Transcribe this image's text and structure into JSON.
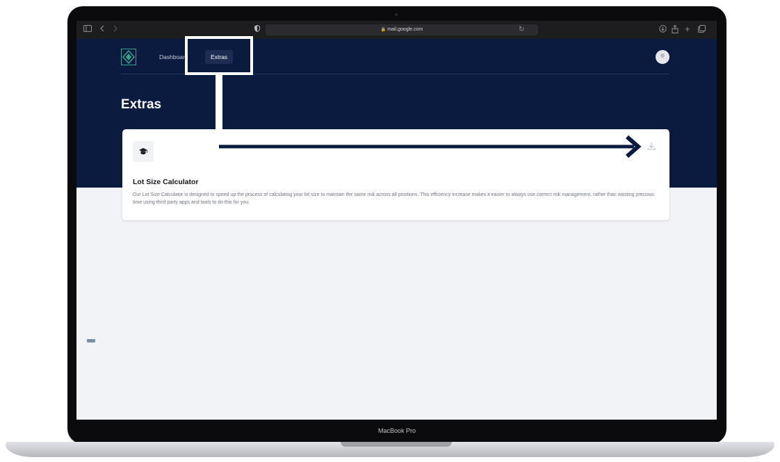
{
  "browser": {
    "url": "mail.google.com",
    "icons": [
      "sidebar-icon",
      "back-icon",
      "forward-icon",
      "shield-icon",
      "lock-icon",
      "reload-icon",
      "download-icon",
      "share-icon",
      "new-tab-icon",
      "tabs-icon"
    ]
  },
  "app": {
    "nav": {
      "dashboard_label": "Dashboard",
      "extras_label": "Extras"
    },
    "page_title": "Extras",
    "card": {
      "icon": "graduation-cap-icon",
      "title": "Lot Size Calculator",
      "description": "Our Lot Size Calculator is designed to speed up the process of calculating your lot size to maintain the same risk across all positions. This efficiency increase makes it easier to always use correct risk management, rather than wasting precious time using third party apps and tools to do this for you.",
      "action_icon": "download-icon"
    },
    "colors": {
      "header_bg": "#0b1b3f",
      "page_bg": "#f1f3f6",
      "card_bg": "#ffffff",
      "logo_accent": "#2fa889"
    }
  },
  "device": {
    "label": "MacBook Pro"
  }
}
